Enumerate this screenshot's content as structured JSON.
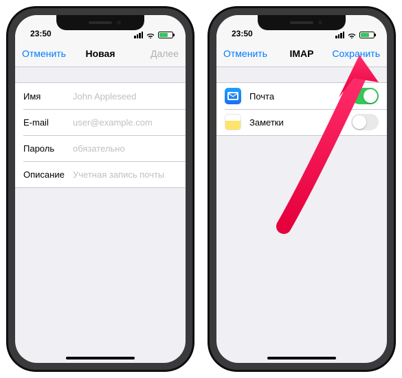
{
  "status": {
    "time": "23:50"
  },
  "left": {
    "nav": {
      "cancel": "Отменить",
      "title": "Новая",
      "next": "Далее"
    },
    "fields": [
      {
        "label": "Имя",
        "placeholder": "John Appleseed"
      },
      {
        "label": "E-mail",
        "placeholder": "user@example.com"
      },
      {
        "label": "Пароль",
        "placeholder": "обязательно"
      },
      {
        "label": "Описание",
        "placeholder": "Учетная запись почты"
      }
    ]
  },
  "right": {
    "nav": {
      "cancel": "Отменить",
      "title": "IMAP",
      "save": "Сохранить"
    },
    "items": [
      {
        "icon": "mail",
        "label": "Почта",
        "on": true
      },
      {
        "icon": "notes",
        "label": "Заметки",
        "on": false
      }
    ]
  }
}
